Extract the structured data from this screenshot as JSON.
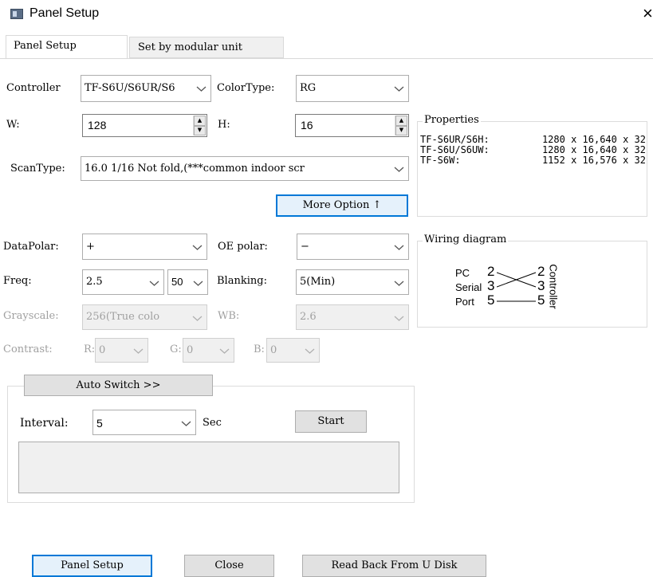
{
  "window": {
    "title": "Panel Setup",
    "close_glyph": "×"
  },
  "tabs": [
    {
      "label": "Panel Setup"
    },
    {
      "label": "Set by modular unit"
    }
  ],
  "form": {
    "controller_label": "Controller",
    "controller_value": "TF-S6U/S6UR/S6",
    "colortype_label": "ColorType:",
    "colortype_value": "RG",
    "w_label": "W:",
    "w_value": "128",
    "h_label": "H:",
    "h_value": "16",
    "scantype_label": "ScanType:",
    "scantype_value": "16.0 1/16 Not fold,(***common indoor scr",
    "more_option_label": "More Option ↑",
    "datapolar_label": "DataPolar:",
    "datapolar_value": "+",
    "oe_polar_label": "OE polar:",
    "oe_polar_value": "−",
    "freq_label": "Freq:",
    "freq_value": "2.5",
    "freq_value2": "50",
    "blanking_label": "Blanking:",
    "blanking_value": "5(Min)",
    "grayscale_label": "Grayscale:",
    "grayscale_value": "256(True colo",
    "wb_label": "WB:",
    "wb_value": "2.6",
    "contrast_label": "Contrast:",
    "r_label": "R:",
    "r_value": "0",
    "g_label": "G:",
    "g_value": "0",
    "b_label": "B:",
    "b_value": "0"
  },
  "properties": {
    "title": "Properties",
    "rows": [
      {
        "model": "TF-S6UR/S6H:",
        "value": "1280 x 16,640 x 32"
      },
      {
        "model": "TF-S6U/S6UW:",
        "value": "1280 x 16,640 x 32"
      },
      {
        "model": "TF-S6W:",
        "value": "1152 x 16,576 x 32"
      }
    ]
  },
  "wiring": {
    "title": "Wiring diagram",
    "left_labels": [
      "PC",
      "Serial",
      "Port"
    ],
    "left_pins": [
      "2",
      "3",
      "5"
    ],
    "right_pins": [
      "2",
      "3",
      "5"
    ],
    "right_label": "Controller"
  },
  "auto_switch": {
    "button_label": "Auto Switch >>",
    "interval_label": "Interval:",
    "interval_value": "5",
    "unit_label": "Sec",
    "start_label": "Start"
  },
  "footer": {
    "panel_setup_label": "Panel Setup",
    "close_label": "Close",
    "read_back_label": "Read Back From U Disk"
  }
}
